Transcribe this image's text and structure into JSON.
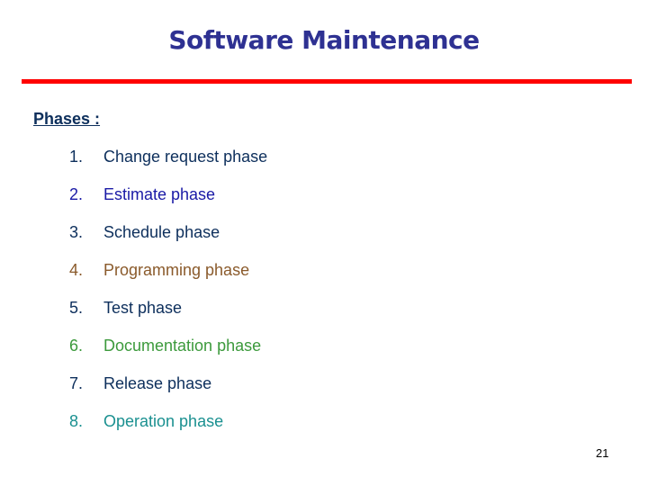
{
  "slide": {
    "title": "Software Maintenance",
    "title_color": "#2e3192",
    "rule_color": "#ff0000",
    "heading": "Phases :",
    "heading_color": "#0d2f5c",
    "phases": [
      {
        "number": "1.",
        "label": "Change request phase",
        "color": "#0d2f5c"
      },
      {
        "number": "2.",
        "label": "Estimate phase",
        "color": "#1a1aa6"
      },
      {
        "number": "3.",
        "label": "Schedule phase",
        "color": "#0d2f5c"
      },
      {
        "number": "4.",
        "label": "Programming phase",
        "color": "#8a5a2b"
      },
      {
        "number": "5.",
        "label": "Test phase",
        "color": "#0d2f5c"
      },
      {
        "number": "6.",
        "label": "Documentation phase",
        "color": "#3c9a3c"
      },
      {
        "number": "7.",
        "label": "Release phase",
        "color": "#0d2f5c"
      },
      {
        "number": "8.",
        "label": "Operation phase",
        "color": "#1a9090"
      }
    ],
    "page_number": "21"
  }
}
